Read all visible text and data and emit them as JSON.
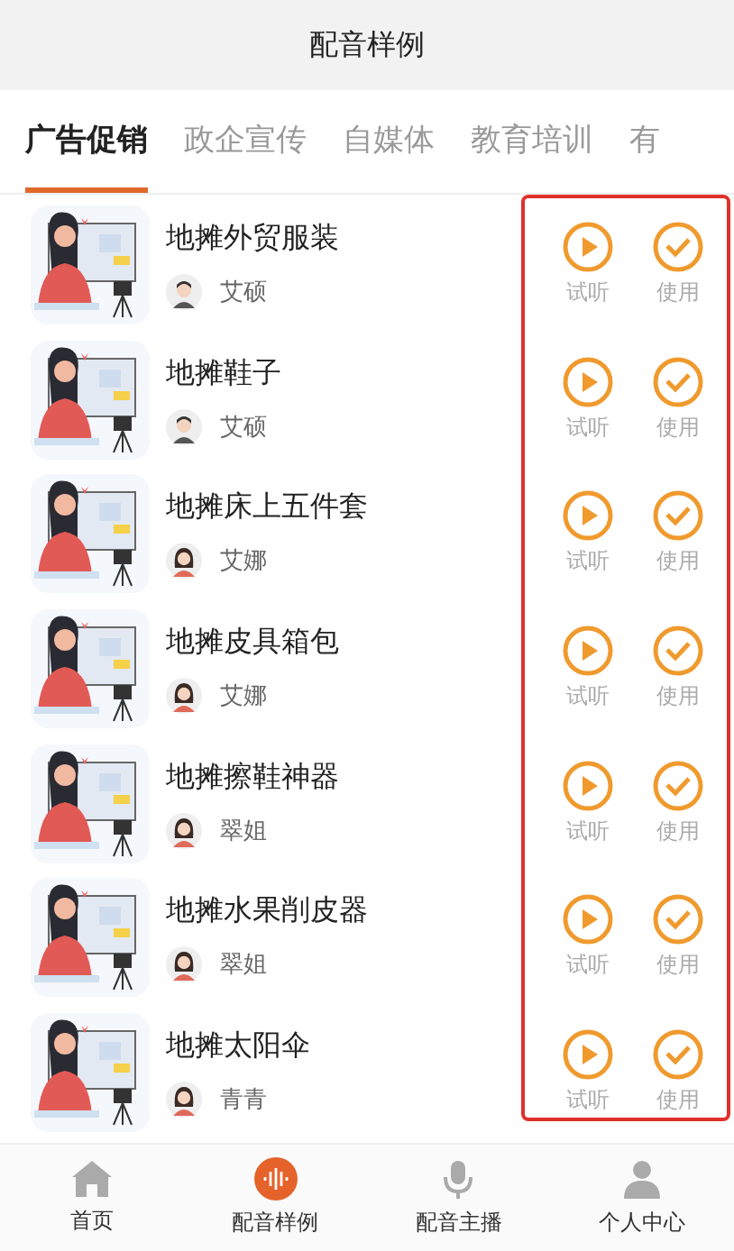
{
  "header": {
    "title": "配音样例"
  },
  "tabs": [
    {
      "label": "广告促销",
      "selected": true
    },
    {
      "label": "政企宣传",
      "selected": false
    },
    {
      "label": "自媒体",
      "selected": false
    },
    {
      "label": "教育培训",
      "selected": false
    },
    {
      "label": "有",
      "selected": false
    }
  ],
  "samples": [
    {
      "title": "地摊外贸服装",
      "speaker": "艾硕",
      "kind": "male",
      "play": "试听",
      "use": "使用"
    },
    {
      "title": "地摊鞋子",
      "speaker": "艾硕",
      "kind": "male",
      "play": "试听",
      "use": "使用"
    },
    {
      "title": "地摊床上五件套",
      "speaker": "艾娜",
      "kind": "female",
      "play": "试听",
      "use": "使用"
    },
    {
      "title": "地摊皮具箱包",
      "speaker": "艾娜",
      "kind": "female",
      "play": "试听",
      "use": "使用"
    },
    {
      "title": "地摊擦鞋神器",
      "speaker": "翠姐",
      "kind": "female",
      "play": "试听",
      "use": "使用"
    },
    {
      "title": "地摊水果削皮器",
      "speaker": "翠姐",
      "kind": "female",
      "play": "试听",
      "use": "使用"
    },
    {
      "title": "地摊太阳伞",
      "speaker": "青青",
      "kind": "female",
      "play": "试听",
      "use": "使用"
    }
  ],
  "bottom_nav": [
    {
      "label": "首页",
      "selected": false
    },
    {
      "label": "配音样例",
      "selected": true
    },
    {
      "label": "配音主播",
      "selected": false
    },
    {
      "label": "个人中心",
      "selected": false
    }
  ]
}
